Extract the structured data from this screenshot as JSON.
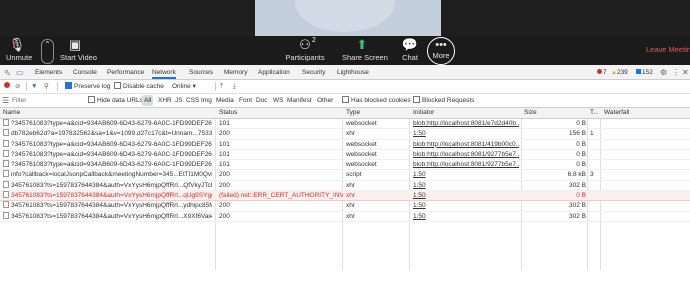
{
  "zoom": {
    "unmute_label": "Unmute",
    "start_video_label": "Start Video",
    "participants_label": "Participants",
    "participants_count": "2",
    "share_screen_label": "Share Screen",
    "chat_label": "Chat",
    "more_label": "More",
    "leave_label": "Leave Meeting"
  },
  "devtools": {
    "tabs": [
      "Elements",
      "Console",
      "Performance",
      "Network",
      "Sources",
      "Memory",
      "Application",
      "Security",
      "Lighthouse"
    ],
    "active_tab": "Network",
    "errors": "7",
    "warnings": "239",
    "infos": "152",
    "toolbar": {
      "preserve_log": "Preserve log",
      "disable_cache": "Disable cache",
      "throttling": "Online"
    },
    "filter": {
      "placeholder": "Filter",
      "hide_data_urls": "Hide data URLs",
      "types": [
        "All",
        "XHR",
        "JS",
        "CSS",
        "Img",
        "Media",
        "Font",
        "Doc",
        "WS",
        "Manifest",
        "Other"
      ],
      "selected_type": "All",
      "has_blocked_cookies": "Has blocked cookies",
      "blocked_requests": "Blocked Requests"
    },
    "columns": [
      "Name",
      "Status",
      "Type",
      "Initiator",
      "Size",
      "T...",
      "Waterfall"
    ],
    "rows": [
      {
        "name": "?345761083?type=a&cid=934AB609-6D43-6279-6A0C-1FD99DEF2680...",
        "status": "101",
        "type": "websocket",
        "initiator": "blob:http://localhost:8081/e7d2d40b...",
        "size": "0 B",
        "time": "",
        "error": false
      },
      {
        "name": "db782eb62d?a=197832562&sa=1&v=1099.d27c17c&t=Unnam...753372...",
        "status": "200",
        "type": "xhr",
        "initiator": "1:50",
        "size": "156 B",
        "time": "1",
        "error": false
      },
      {
        "name": "?345761083?type=a&cid=934AB609-6D43-6279-6A0C-1FD99DEF2680...",
        "status": "101",
        "type": "websocket",
        "initiator": "blob:http://localhost:8081/419b00c0...",
        "size": "0 B",
        "time": "",
        "error": false
      },
      {
        "name": "?345761083?type=a&cid=934AB609-6D43-6279-6A0C-1FD99DEF2680...",
        "status": "101",
        "type": "websocket",
        "initiator": "blob:http://localhost:8081/9277b5e7...",
        "size": "0 B",
        "time": "",
        "error": false
      },
      {
        "name": "?345761083?type=a&cid=934AB609-6D43-6279-6A0C-1FD99DEF2680...",
        "status": "101",
        "type": "websocket",
        "initiator": "blob:http://localhost:8081/9277b5e7...",
        "size": "0 B",
        "time": "",
        "error": false
      },
      {
        "name": "info?callback=localJsonpCallback&meetingNumber=345...EtTl1M0QvMQ...",
        "status": "200",
        "type": "script",
        "initiator": "1:50",
        "size": "6.8 kB",
        "time": "3",
        "error": false
      },
      {
        "name": "345761083?ts=1597837644384&auth=VxYysH6mjpQffRrl...QfVkyJTcPy...",
        "status": "200",
        "type": "xhr",
        "initiator": "1:50",
        "size": "302 B",
        "time": "",
        "error": false
      },
      {
        "name": "345761083?ts=1597837644384&auth=VxYysH6mjpQffRrl...qUg9SYggZl...",
        "status": "(failed) net::ERR_CERT_AUTHORITY_INVALID",
        "type": "xhr",
        "initiator": "1:50",
        "size": "0 B",
        "time": "",
        "error": true
      },
      {
        "name": "345761083?ts=1597837644384&auth=VxYysH6mjpQffRrl...ydhipc85M6...",
        "status": "200",
        "type": "xhr",
        "initiator": "1:50",
        "size": "302 B",
        "time": "",
        "error": false
      },
      {
        "name": "345761083?ts=1597837644384&auth=VxYysH6mjpQffRrl...X9Xf6Vaie99...",
        "status": "200",
        "type": "xhr",
        "initiator": "1:50",
        "size": "302 B",
        "time": "",
        "error": false
      }
    ]
  },
  "colors": {
    "accent": "#1a73e8",
    "error": "#d93025",
    "leave": "#ff4f4f",
    "share": "#3ec46d"
  }
}
